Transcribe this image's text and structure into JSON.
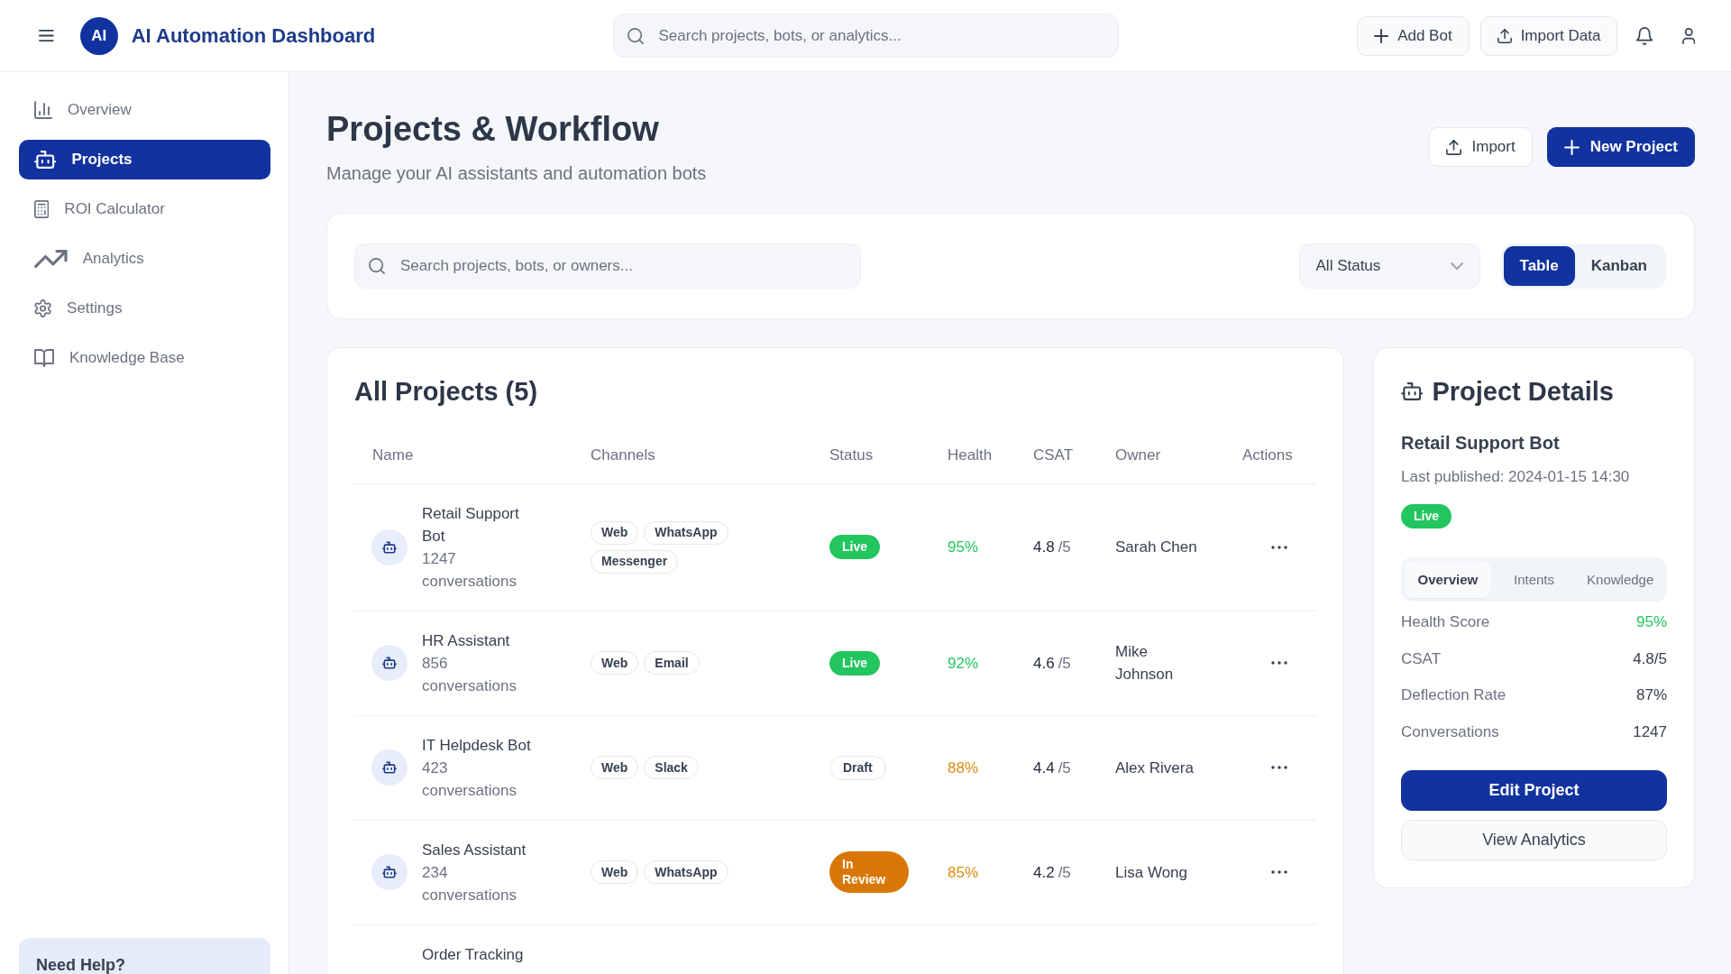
{
  "header": {
    "logo": "AI",
    "title": "AI Automation Dashboard",
    "search": {
      "placeholder": "Search projects, bots, or analytics..."
    },
    "buttons": [
      {
        "label": "Add Bot"
      },
      {
        "label": "Import Data"
      }
    ]
  },
  "sidebar": {
    "items": [
      {
        "label": "Overview",
        "selected": false
      },
      {
        "label": "Projects",
        "selected": true
      },
      {
        "label": "ROI Calculator",
        "selected": false
      },
      {
        "label": "Analytics",
        "selected": false
      },
      {
        "label": "Settings",
        "selected": false
      },
      {
        "label": "Knowledge Base",
        "selected": false
      }
    ],
    "help": {
      "title": "Need Help?"
    }
  },
  "page": {
    "title": "Projects & Workflow",
    "subtitle": "Manage your AI assistants and automation bots",
    "buttons": [
      {
        "label": "Import",
        "kind": "secondary"
      },
      {
        "label": "New Project",
        "kind": "primary"
      }
    ]
  },
  "filters": {
    "search": {
      "placeholder": "Search projects, bots, or owners..."
    },
    "status_filter": {
      "value": "All Status"
    },
    "views": [
      {
        "label": "Table",
        "selected": true
      },
      {
        "label": "Kanban",
        "selected": false
      }
    ]
  },
  "projects": {
    "title": "All Projects (5)",
    "columns": [
      "Name",
      "Channels",
      "Status",
      "Health",
      "CSAT",
      "Owner",
      "Actions"
    ],
    "rows": [
      {
        "name": "Retail Support Bot",
        "conversations": "1247 conversations",
        "channels": [
          "Web",
          "WhatsApp",
          "Messenger"
        ],
        "status": {
          "label": "Live",
          "kind": "live"
        },
        "health": {
          "value": "95%",
          "color": "#22c55e"
        },
        "csat": {
          "score": "4.8",
          "scale": "/5"
        },
        "owner": "Sarah Chen"
      },
      {
        "name": "HR Assistant",
        "conversations": "856 conversations",
        "channels": [
          "Web",
          "Email"
        ],
        "status": {
          "label": "Live",
          "kind": "live"
        },
        "health": {
          "value": "92%",
          "color": "#22c55e"
        },
        "csat": {
          "score": "4.6",
          "scale": "/5"
        },
        "owner": "Mike Johnson"
      },
      {
        "name": "IT Helpdesk Bot",
        "conversations": "423 conversations",
        "channels": [
          "Web",
          "Slack"
        ],
        "status": {
          "label": "Draft",
          "kind": "draft"
        },
        "health": {
          "value": "88%",
          "color": "#dd8a12"
        },
        "csat": {
          "score": "4.4",
          "scale": "/5"
        },
        "owner": "Alex Rivera"
      },
      {
        "name": "Sales Assistant",
        "conversations": "234 conversations",
        "channels": [
          "Web",
          "WhatsApp"
        ],
        "status": {
          "label": "In Review",
          "kind": "review"
        },
        "health": {
          "value": "85%",
          "color": "#dd8a12"
        },
        "csat": {
          "score": "4.2",
          "scale": "/5"
        },
        "owner": "Lisa Wong"
      },
      {
        "name": "Order Tracking"
      }
    ]
  },
  "details": {
    "title": "Project Details",
    "name": "Retail Support Bot",
    "published": "Last published: 2024-01-15 14:30",
    "status": {
      "label": "Live",
      "kind": "live"
    },
    "tabs": [
      {
        "label": "Overview",
        "selected": true
      },
      {
        "label": "Intents",
        "selected": false
      },
      {
        "label": "Knowledge",
        "selected": false
      }
    ],
    "metrics": [
      {
        "label": "Health Score",
        "value": "95%",
        "color": "#22c55e"
      },
      {
        "label": "CSAT",
        "value": "4.8/5"
      },
      {
        "label": "Deflection Rate",
        "value": "87%"
      },
      {
        "label": "Conversations",
        "value": "1247"
      }
    ],
    "buttons": [
      {
        "label": "Edit Project",
        "kind": "primary"
      },
      {
        "label": "View Analytics",
        "kind": "secondary"
      }
    ]
  }
}
